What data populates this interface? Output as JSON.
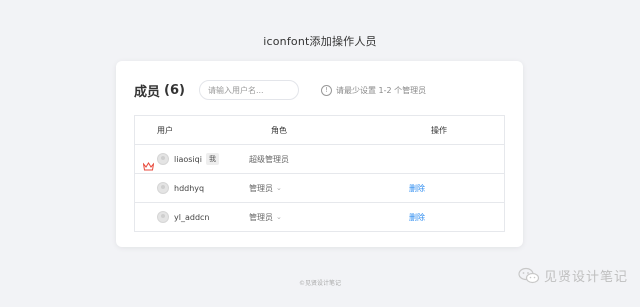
{
  "page": {
    "title": "iconfont添加操作人员"
  },
  "members": {
    "title": "成员",
    "count": "(6)",
    "search_placeholder": "请输入用户名...",
    "hint": "请最少设置 1-2 个管理员"
  },
  "table": {
    "headers": {
      "user": "用户",
      "role": "角色",
      "action": "操作"
    },
    "rows": [
      {
        "username": "liaosiqi",
        "badge": "我",
        "role": "超级管理员",
        "action": ""
      },
      {
        "username": "hddhyq",
        "badge": "",
        "role": "管理员",
        "action": "删除"
      },
      {
        "username": "yl_addcn",
        "badge": "",
        "role": "管理员",
        "action": "删除"
      }
    ]
  },
  "footer": {
    "text": "©见贤设计笔记"
  },
  "watermark": {
    "text": "见贤设计笔记"
  },
  "colors": {
    "accent": "#2d8cf0",
    "crown": "#e84a3c",
    "background": "#f2f3f6"
  },
  "icons": [
    "info-icon",
    "crown-icon",
    "chevron-down-icon",
    "wechat-icon"
  ]
}
